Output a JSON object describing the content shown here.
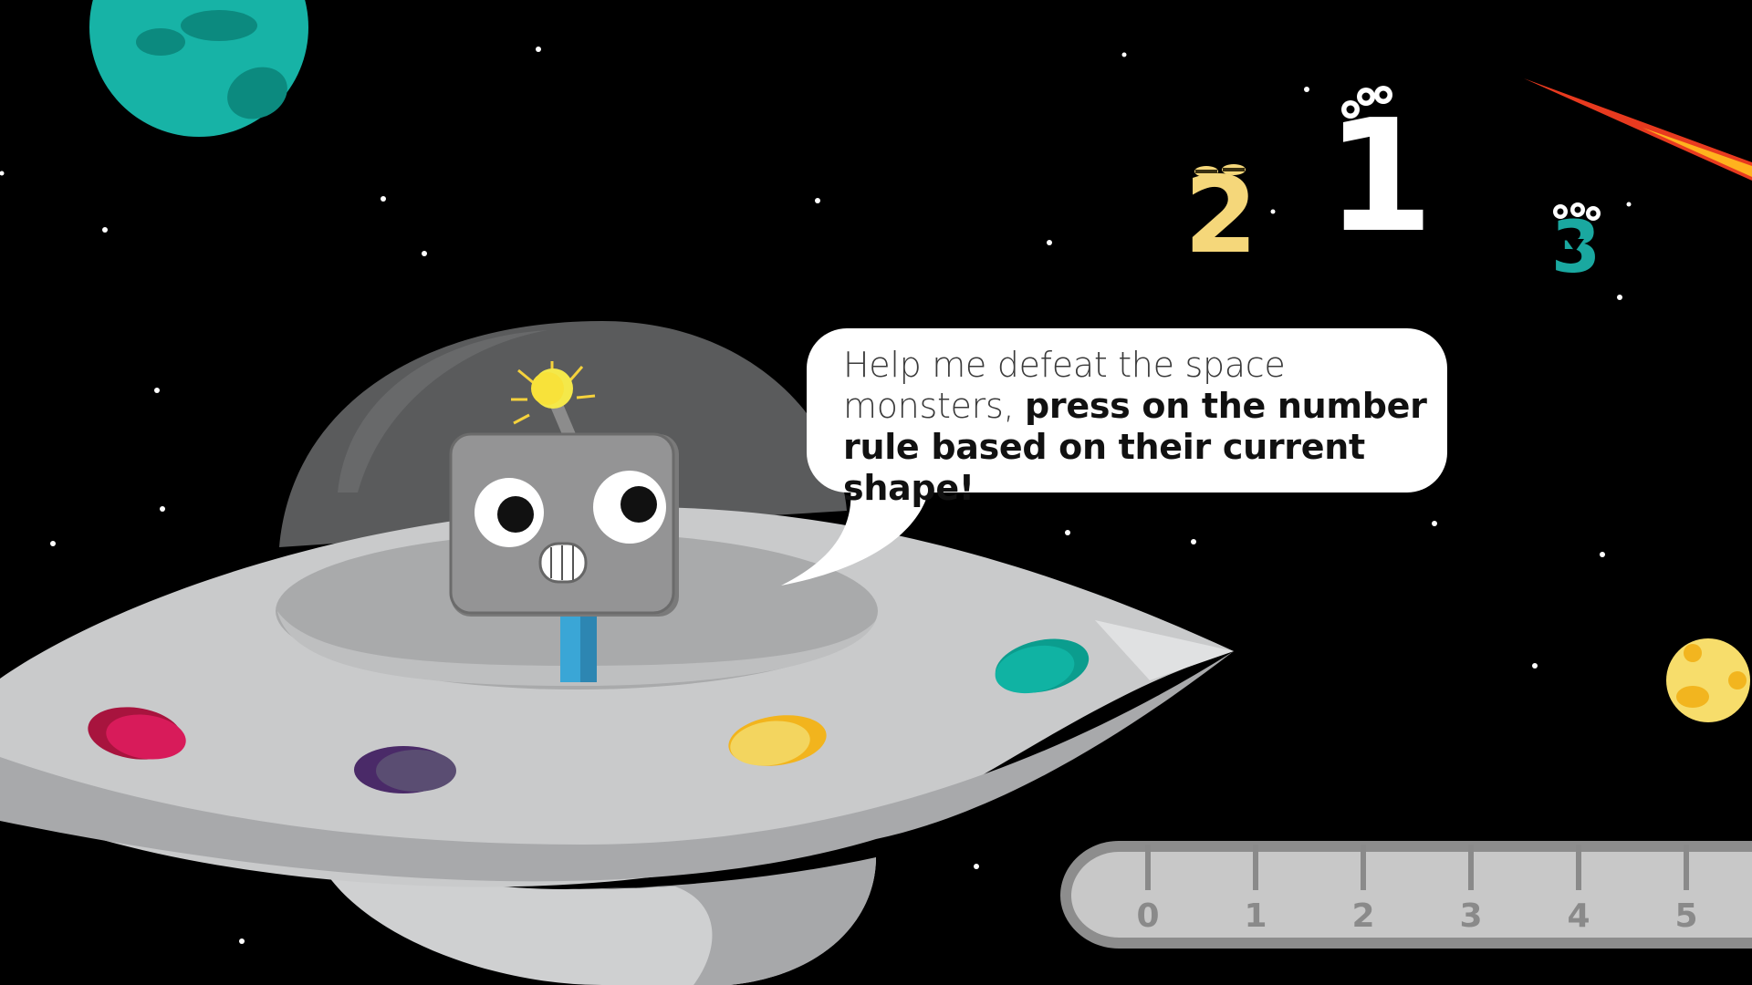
{
  "speech": {
    "text_regular": "Help me defeat the space monsters, ",
    "text_bold": "press on the number rule based on their current shape!"
  },
  "monsters": [
    {
      "digit": "1",
      "color": "#ffffff"
    },
    {
      "digit": "2",
      "color": "#f5d77a"
    },
    {
      "digit": "3",
      "color": "#1aa8a0"
    }
  ],
  "number_rule": {
    "ticks": [
      "0",
      "1",
      "2",
      "3",
      "4",
      "5"
    ]
  },
  "ufo_lights": [
    {
      "name": "red-light",
      "color": "#d81b5a"
    },
    {
      "name": "purple-light",
      "color": "#5a3d78"
    },
    {
      "name": "yellow-light",
      "color": "#f3d55f"
    },
    {
      "name": "teal-light",
      "color": "#10b3a3"
    }
  ],
  "colors": {
    "background": "#000000",
    "ufo_body": "#c9cacb",
    "robot_head": "#8c8c8c",
    "teal_planet": "#17b3a6",
    "yellow_planet": "#f7dd6b",
    "ruler": "#c8c8c8"
  }
}
